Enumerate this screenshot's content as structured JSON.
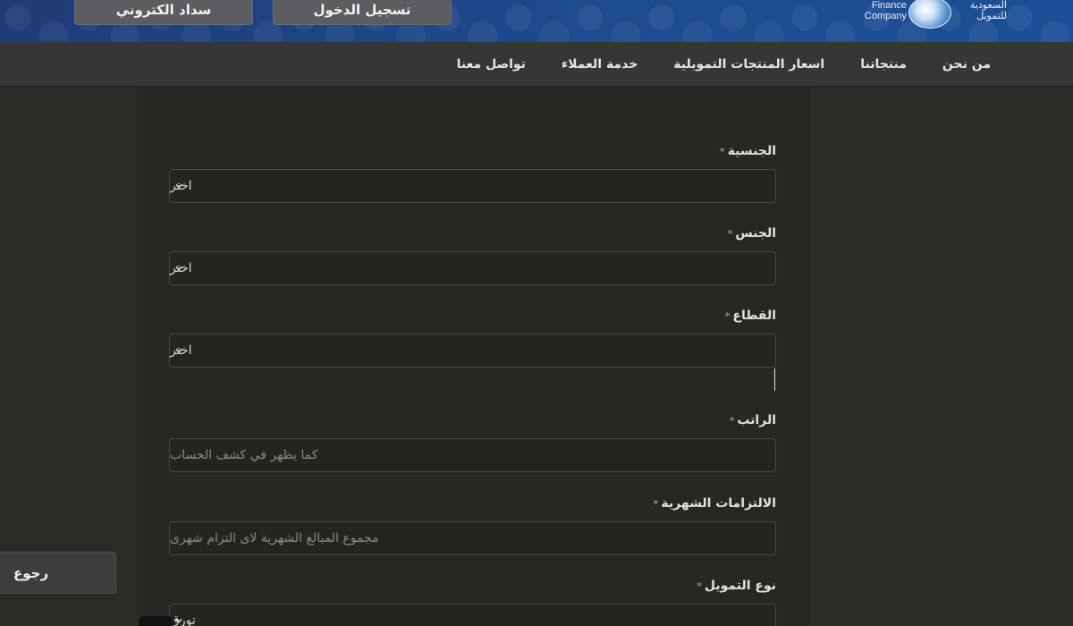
{
  "header": {
    "pay_button": "سداد الكتروني",
    "login_button": "تسجيل الدخول",
    "logo_en": "Finance Company",
    "logo_ar": "السعودية للتمويل"
  },
  "nav": {
    "items": [
      "من نحن",
      "منتجاتنا",
      "اسعار المنتجات التمويلية",
      "خدمة العملاء",
      "تواصل معنا"
    ]
  },
  "form": {
    "nationality": {
      "label": "الجنسية",
      "value": "اختر"
    },
    "gender": {
      "label": "الجنس",
      "value": "اختر"
    },
    "sector": {
      "label": "القطاع",
      "value": "اختر"
    },
    "salary": {
      "label": "الراتب",
      "placeholder": "كما يظهر في كشف الحساب"
    },
    "obligations": {
      "label": "الالتزامات الشهرية",
      "placeholder": "مجموع المبالغ الشهرية لاى التزام شهرى"
    },
    "finance_type": {
      "label": "نوع التمويل",
      "value": "تورق"
    },
    "required_mark": "*"
  },
  "back_button": "رجوع",
  "colors": {
    "header_blue": "#1e4a8f",
    "nav_bg": "#363636",
    "panel_bg": "#282723"
  },
  "icons": {
    "select_chevron": "chevron-down-icon"
  }
}
